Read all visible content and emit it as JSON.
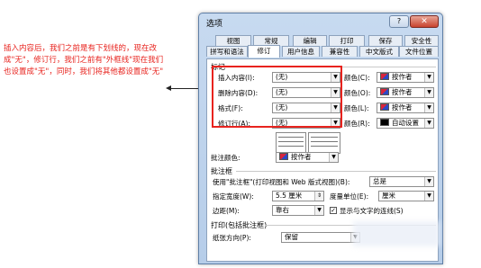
{
  "annotation": "插入内容后，我们之前是有下划线的，现在改成\"无\"，修订行，我们之前有\"外框线\"现在我们也设置成\"无\"，同时，我们将其他都设置成\"无\"",
  "dialog": {
    "title": "选项",
    "help_label": "?",
    "close_label": "✕",
    "tabs_row1": [
      "视图",
      "常规",
      "编辑",
      "打印",
      "保存",
      "安全性"
    ],
    "tabs_row2": [
      "拼写和语法",
      "修订",
      "用户信息",
      "兼容性",
      "中文版式",
      "文件位置"
    ],
    "active_tab": "修订"
  },
  "markup": {
    "group_title": "标记",
    "rows": [
      {
        "label": "插入内容(I):",
        "value": "(无)",
        "color_label": "颜色(C):",
        "color": "按作者"
      },
      {
        "label": "删除内容(D):",
        "value": "(无)",
        "color_label": "颜色(O):",
        "color": "按作者"
      },
      {
        "label": "格式(F):",
        "value": "(无)",
        "color_label": "颜色(L):",
        "color": "按作者"
      },
      {
        "label": "修订行(A):",
        "value": "(无)",
        "color_label": "颜色(R):",
        "color": "自动设置"
      }
    ],
    "comment_color_label": "批注颜色:",
    "comment_color": "按作者"
  },
  "balloons": {
    "group_title": "批注框",
    "use_label": "使用\"批注框\"(打印视图和 Web 版式视图)(B):",
    "use_value": "总是",
    "width_label": "指定宽度(W):",
    "width_value": "5.5 厘米",
    "unit_label": "度量单位(E):",
    "unit_value": "厘米",
    "margin_label": "边距(M):",
    "margin_value": "靠右",
    "lines_label": "显示与文字的连线(S)",
    "lines_checked": true
  },
  "printing": {
    "group_title": "打印(包括批注框)",
    "orientation_label": "纸张方向(P):",
    "orientation_value": "保留"
  },
  "colors": {
    "annotation_red": "#e8231e",
    "red_box": "#e8231e"
  }
}
